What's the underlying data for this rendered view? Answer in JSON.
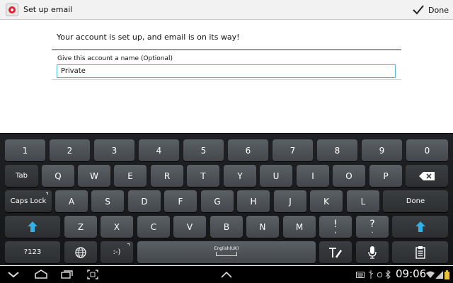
{
  "app": {
    "title": "Set up email",
    "done_label": "Done",
    "icon": "email-app-icon"
  },
  "content": {
    "message": "Your account is set up, and email is on its way!",
    "name_field": {
      "label": "Give this account a name (Optional)",
      "value": "Private"
    }
  },
  "keyboard": {
    "number_row": [
      "1",
      "2",
      "3",
      "4",
      "5",
      "6",
      "7",
      "8",
      "9",
      "0"
    ],
    "top_row": [
      "Q",
      "W",
      "E",
      "R",
      "T",
      "Y",
      "U",
      "I",
      "O",
      "P"
    ],
    "home_row": [
      "A",
      "S",
      "D",
      "F",
      "G",
      "H",
      "J",
      "K",
      "L"
    ],
    "bottom_row": [
      "Z",
      "X",
      "C",
      "V",
      "B",
      "N",
      "M"
    ],
    "tab_label": "Tab",
    "caps_lock_label": "Caps Lock",
    "done_label": "Done",
    "symbols_label": "?123",
    "emoticon_label": ":-)",
    "space_label": "English(UK)",
    "exclamation": "!",
    "question": "?",
    "punct_small_1": ",",
    "punct_small_2": ".",
    "accent_color": "#2fb2e9"
  },
  "status": {
    "time": "09:06",
    "icons": [
      "keyboard-icon",
      "usb-icon",
      "sync-icon",
      "bluetooth-icon",
      "wifi-icon",
      "signal-icon",
      "battery-icon"
    ]
  },
  "nav": {
    "icons": [
      "back-icon",
      "home-icon",
      "recent-apps-icon",
      "screenshot-icon",
      "keyboard-hide-icon"
    ]
  }
}
